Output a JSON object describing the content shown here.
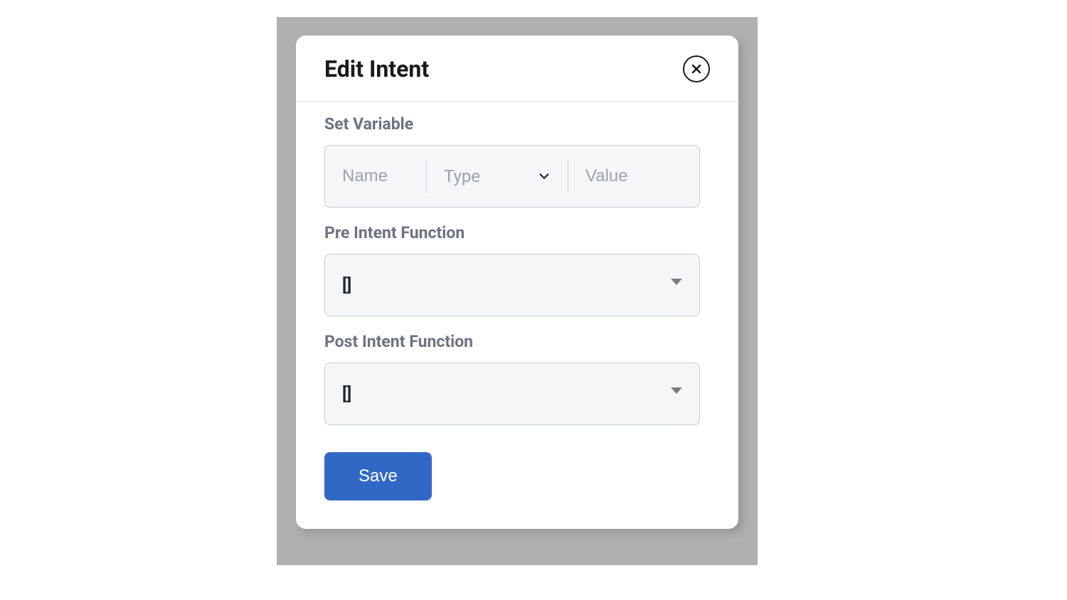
{
  "modal": {
    "title": "Edit Intent",
    "fields": {
      "set_variable": {
        "label": "Set Variable",
        "name_placeholder": "Name",
        "type_placeholder": "Type",
        "value_placeholder": "Value",
        "name_value": "",
        "type_value": "",
        "value_value": ""
      },
      "pre_intent": {
        "label": "Pre Intent Function",
        "value": "[]"
      },
      "post_intent": {
        "label": "Post Intent Function",
        "value": "[]"
      }
    },
    "save_label": "Save"
  }
}
